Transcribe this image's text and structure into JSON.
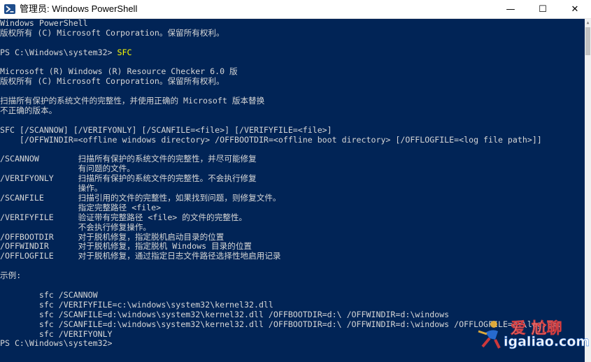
{
  "window": {
    "title": "管理员: Windows PowerShell",
    "min_glyph": "—",
    "max_glyph": "☐",
    "close_glyph": "✕"
  },
  "console": {
    "lines": [
      {
        "text": "Windows PowerShell"
      },
      {
        "text": "版权所有 (C) Microsoft Corporation。保留所有权利。"
      },
      {
        "text": ""
      },
      {
        "prompt": "PS C:\\Windows\\system32> ",
        "cmd": "SFC"
      },
      {
        "text": ""
      },
      {
        "text": "Microsoft (R) Windows (R) Resource Checker 6.0 版"
      },
      {
        "text": "版权所有 (C) Microsoft Corporation。保留所有权利。"
      },
      {
        "text": ""
      },
      {
        "text": "扫描所有保护的系统文件的完整性，并使用正确的 Microsoft 版本替换"
      },
      {
        "text": "不正确的版本。"
      },
      {
        "text": ""
      },
      {
        "text": "SFC [/SCANNOW] [/VERIFYONLY] [/SCANFILE=<file>] [/VERIFYFILE=<file>]"
      },
      {
        "text": "    [/OFFWINDIR=<offline windows directory> /OFFBOOTDIR=<offline boot directory> [/OFFLOGFILE=<log file path>]]"
      },
      {
        "text": ""
      },
      {
        "text": "/SCANNOW        扫描所有保护的系统文件的完整性，并尽可能修复"
      },
      {
        "text": "                有问题的文件。"
      },
      {
        "text": "/VERIFYONLY     扫描所有保护的系统文件的完整性。不会执行修复"
      },
      {
        "text": "                操作。"
      },
      {
        "text": "/SCANFILE       扫描引用的文件的完整性，如果找到问题，则修复文件。"
      },
      {
        "text": "                指定完整路径 <file>"
      },
      {
        "text": "/VERIFYFILE     验证带有完整路径 <file> 的文件的完整性。"
      },
      {
        "text": "                不会执行修复操作。"
      },
      {
        "text": "/OFFBOOTDIR     对于脱机修复，指定脱机启动目录的位置"
      },
      {
        "text": "/OFFWINDIR      对于脱机修复，指定脱机 Windows 目录的位置"
      },
      {
        "text": "/OFFLOGFILE     对于脱机修复，通过指定日志文件路径选择性地启用记录"
      },
      {
        "text": ""
      },
      {
        "text": "示例:"
      },
      {
        "text": ""
      },
      {
        "text": "        sfc /SCANNOW"
      },
      {
        "text": "        sfc /VERIFYFILE=c:\\windows\\system32\\kernel32.dll"
      },
      {
        "text": "        sfc /SCANFILE=d:\\windows\\system32\\kernel32.dll /OFFBOOTDIR=d:\\ /OFFWINDIR=d:\\windows"
      },
      {
        "text": "        sfc /SCANFILE=d:\\windows\\system32\\kernel32.dll /OFFBOOTDIR=d:\\ /OFFWINDIR=d:\\windows /OFFLOGFILE=c:\\log.txt"
      },
      {
        "text": "        sfc /VERIFYONLY"
      },
      {
        "prompt": "PS C:\\Windows\\system32> ",
        "cmd": ""
      }
    ]
  },
  "watermark": {
    "line1": "爱 尬聊",
    "line2": "igaliao.com"
  },
  "colors": {
    "console_bg": "#012456",
    "console_fg": "#d6d6d6",
    "command": "#ffff00",
    "titlebar_bg": "#ffffff"
  }
}
